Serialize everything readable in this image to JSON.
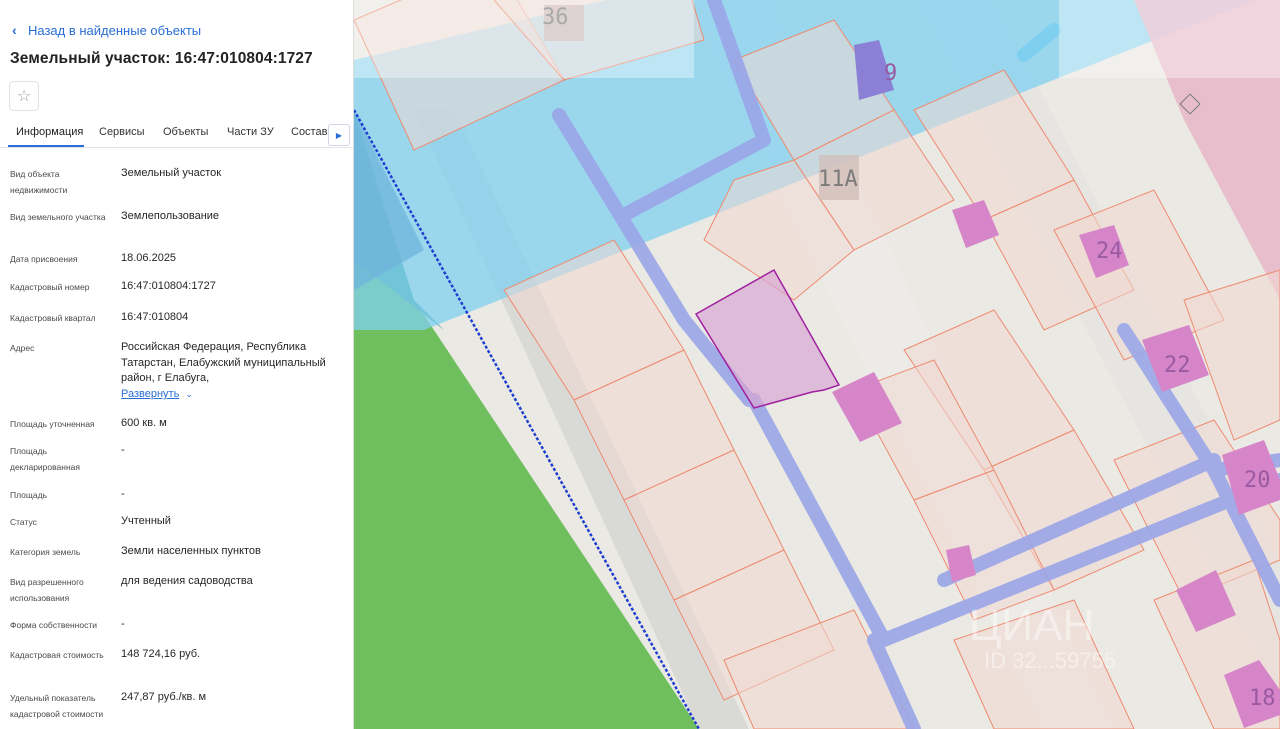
{
  "nav": {
    "back_label": "Назад в найденные объекты"
  },
  "header": {
    "title": "Земельный участок: 16:47:010804:1727"
  },
  "tabs": [
    {
      "label": "Информация",
      "active": true
    },
    {
      "label": "Сервисы"
    },
    {
      "label": "Объекты"
    },
    {
      "label": "Части ЗУ"
    },
    {
      "label": "Состав"
    }
  ],
  "details": [
    {
      "label": "Вид объекта недвижимости",
      "value": "Земельный участок"
    },
    {
      "label": "Вид земельного участка",
      "value": "Землепользование"
    },
    {
      "label": "Дата присвоения",
      "value": "18.06.2025"
    },
    {
      "label": "Кадастровый номер",
      "value": "16:47:010804:1727"
    },
    {
      "label": "Кадастровый квартал",
      "value": "16:47:010804"
    },
    {
      "label": "Адрес",
      "value": "Российская Федерация, Республика Татарстан, Елабужский муниципальный район, г Елабуга,"
    },
    {
      "label": "Площадь уточненная",
      "value": "600 кв. м"
    },
    {
      "label": "Площадь декларированная",
      "value": "-"
    },
    {
      "label": "Площадь",
      "value": "-"
    },
    {
      "label": "Статус",
      "value": "Учтенный"
    },
    {
      "label": "Категория земель",
      "value": "Земли населенных пунктов"
    },
    {
      "label": "Вид разрешенного использования",
      "value": "для ведения садоводства"
    },
    {
      "label": "Форма собственности",
      "value": "-"
    },
    {
      "label": "Кадастровая стоимость",
      "value": "148 724,16 руб."
    },
    {
      "label": "Удельный показатель кадастровой стоимости",
      "value": "247,87 руб./кв. м"
    }
  ],
  "address_expand_label": "Развернуть",
  "map": {
    "house_labels": [
      "36",
      "9",
      "11А",
      "24",
      "22",
      "20",
      "18"
    ],
    "watermark": "ЦИАН",
    "watermark_sub": "ID 32...59755",
    "colors": {
      "plot_fill": "#d9a6d3",
      "plot_border": "#a020a0",
      "road": "#9aa6e8",
      "water_zone": "#7fd0f0",
      "green_zone": "#6fbf5e"
    }
  }
}
